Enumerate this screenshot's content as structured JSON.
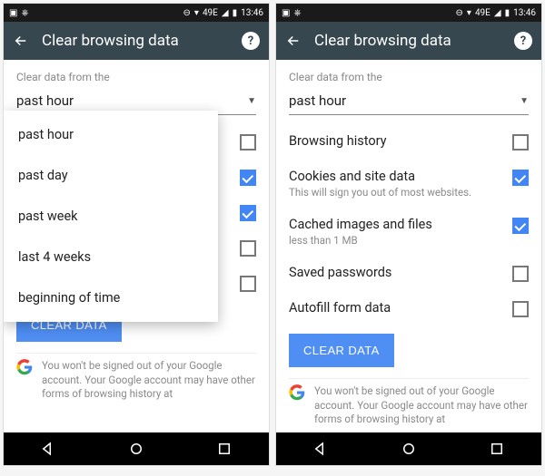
{
  "status": {
    "time": "13:46",
    "signal_label": "49E"
  },
  "appbar": {
    "title": "Clear browsing data"
  },
  "section_label": "Clear data from the",
  "dropdown": {
    "selected": "past hour",
    "options": [
      "past hour",
      "past day",
      "past week",
      "last 4 weeks",
      "beginning of time"
    ]
  },
  "items": [
    {
      "label": "Browsing history",
      "sub": "",
      "checked": false
    },
    {
      "label": "Cookies and site data",
      "sub": "This will sign you out of most websites.",
      "checked": true
    },
    {
      "label": "Cached images and files",
      "sub": "less than 1 MB",
      "checked": true
    },
    {
      "label": "Saved passwords",
      "sub": "",
      "checked": false
    },
    {
      "label": "Autofill form data",
      "sub": "",
      "checked": false
    }
  ],
  "clear_button": "CLEAR DATA",
  "notice": "You won't be signed out of your Google account. Your Google account may have other forms of browsing history at"
}
